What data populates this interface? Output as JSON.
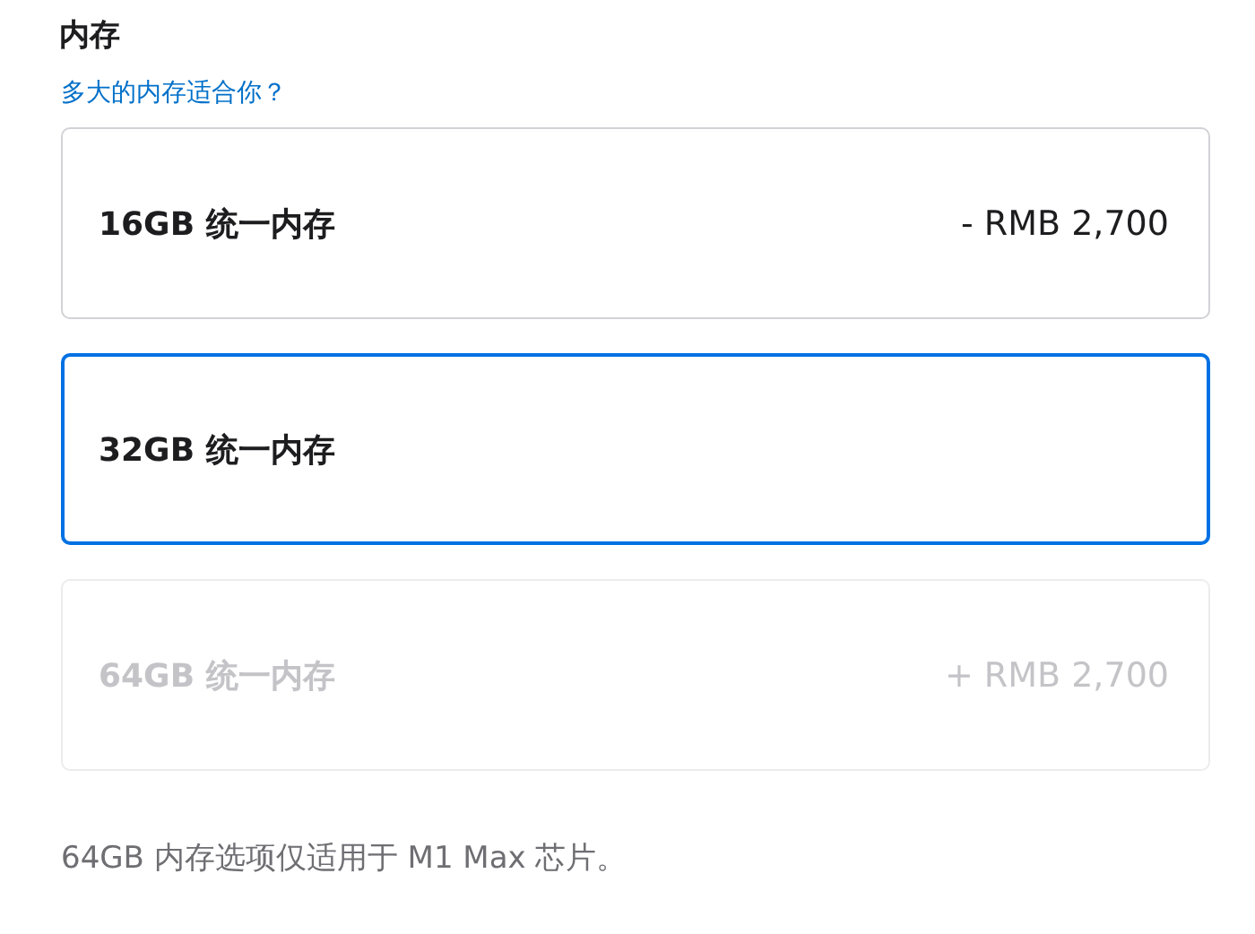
{
  "title": "内存",
  "help_link": "多大的内存适合你？",
  "options": [
    {
      "label": "16GB 统一内存",
      "price": "- RMB 2,700",
      "selected": false,
      "disabled": false
    },
    {
      "label": "32GB 统一内存",
      "selected": true,
      "disabled": false
    },
    {
      "label": "64GB 统一内存",
      "price": "+ RMB 2,700",
      "selected": false,
      "disabled": true
    }
  ],
  "note": "64GB 内存选项仅适用于 M1 Max 芯片。"
}
